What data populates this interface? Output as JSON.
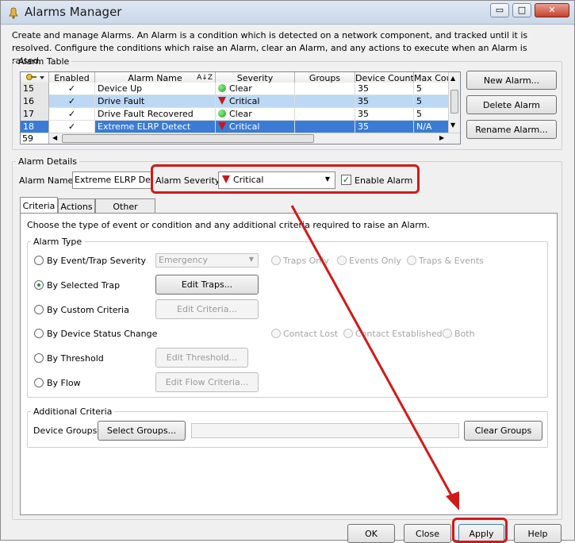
{
  "window": {
    "title": "Alarms Manager",
    "controls": {
      "minimize": "▭",
      "maximize": "□",
      "close": "✕"
    }
  },
  "intro": "Create and manage Alarms. An Alarm is a condition which is detected on a network component, and tracked until it is resolved. Configure the conditions which raise an Alarm, clear an Alarm, and any actions to execute when an Alarm is raised.",
  "alarm_table": {
    "legend": "Alarm Table",
    "columns": [
      "Enabled",
      "Alarm Name",
      "Severity",
      "Groups",
      "Device Count",
      "Max Cou"
    ],
    "rows": [
      {
        "num": "15",
        "enabled": "✓",
        "name": "Device Up",
        "severity": "Clear",
        "sev_kind": "clear",
        "groups": "",
        "count": "35",
        "max": "5"
      },
      {
        "num": "16",
        "enabled": "✓",
        "name": "Drive Fault",
        "severity": "Critical",
        "sev_kind": "critical",
        "groups": "",
        "count": "35",
        "max": "5"
      },
      {
        "num": "17",
        "enabled": "✓",
        "name": "Drive Fault Recovered",
        "severity": "Clear",
        "sev_kind": "clear",
        "groups": "",
        "count": "35",
        "max": "5"
      },
      {
        "num": "18",
        "enabled": "✓",
        "name": "Extreme ELRP Detect",
        "severity": "Critical",
        "sev_kind": "critical",
        "groups": "",
        "count": "35",
        "max": "N/A"
      }
    ],
    "row_total": "59",
    "buttons": {
      "new": "New Alarm...",
      "delete": "Delete Alarm",
      "rename": "Rename Alarm..."
    }
  },
  "alarm_details": {
    "legend": "Alarm Details",
    "name_label": "Alarm Name:",
    "name_value": "Extreme ELRP Detect",
    "severity_label": "Alarm Severity:",
    "severity_value": "Critical",
    "enable_label": "Enable Alarm",
    "enable_checked": true
  },
  "tabs": [
    "Criteria",
    "Actions",
    "Other Options"
  ],
  "criteria": {
    "description": "Choose the type of event or condition and any additional criteria required to raise an Alarm.",
    "alarm_type_legend": "Alarm Type",
    "options": {
      "event_trap": "By Event/Trap Severity",
      "selected_trap": "By Selected Trap",
      "custom": "By Custom Criteria",
      "device_status": "By Device Status Change",
      "threshold": "By Threshold",
      "flow": "By Flow"
    },
    "severity_combo": "Emergency",
    "trap_filters": [
      "Traps Only",
      "Events Only",
      "Traps & Events"
    ],
    "status_filters": [
      "Contact Lost",
      "Contact Established",
      "Both"
    ],
    "buttons": {
      "edit_traps": "Edit Traps...",
      "edit_criteria": "Edit Criteria...",
      "edit_threshold": "Edit Threshold...",
      "edit_flow": "Edit Flow Criteria..."
    },
    "additional_legend": "Additional Criteria",
    "device_groups_label": "Device Groups:",
    "select_groups": "Select Groups...",
    "clear_groups": "Clear Groups"
  },
  "footer": {
    "ok": "OK",
    "close": "Close",
    "apply": "Apply",
    "help": "Help"
  },
  "colors": {
    "annotation": "#d21919",
    "selection": "#3a7bd5",
    "clear": "#1aa01a",
    "critical": "#c41a1a"
  }
}
